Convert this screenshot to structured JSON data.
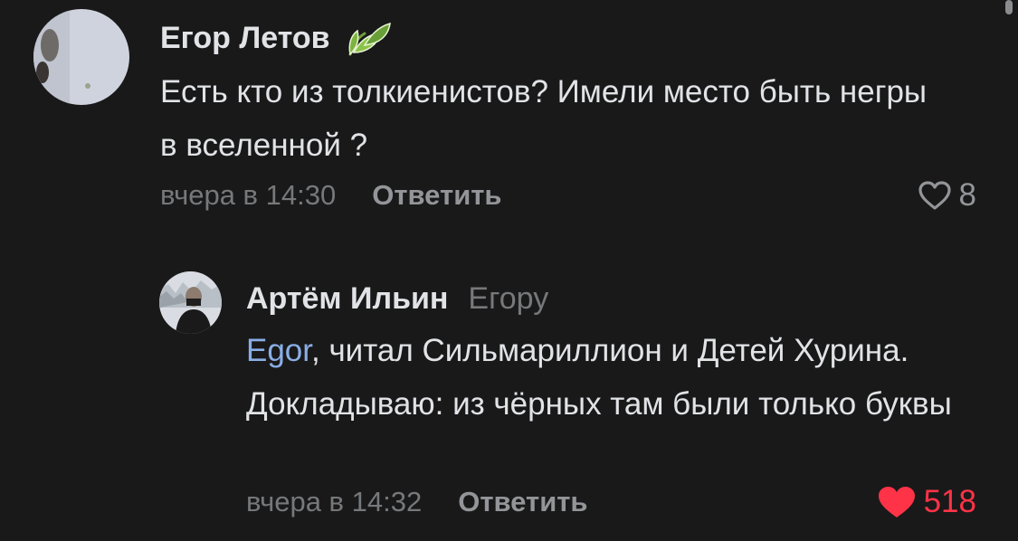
{
  "comments": [
    {
      "author": "Егор Летов",
      "text": "Есть кто из толкиенистов? Имели место быть негры в вселенной ?",
      "time": "вчера в 14:30",
      "reply_label": "Ответить",
      "likes": "8",
      "liked": false,
      "badge_icon": "leaf-badge-icon"
    },
    {
      "author": "Артём Ильин",
      "reply_to": "Егору",
      "mention": "Egor",
      "text_after_mention": ", читал Сильмариллион и Детей Хурина. Докладываю: из чёрных там были только буквы",
      "time": "вчера в 14:32",
      "reply_label": "Ответить",
      "likes": "518",
      "liked": true
    }
  ],
  "colors": {
    "background": "#19191a",
    "text_primary": "#e1e3e6",
    "text_secondary": "#76787a",
    "mention": "#8aaee6",
    "like_active": "#ff3347"
  }
}
